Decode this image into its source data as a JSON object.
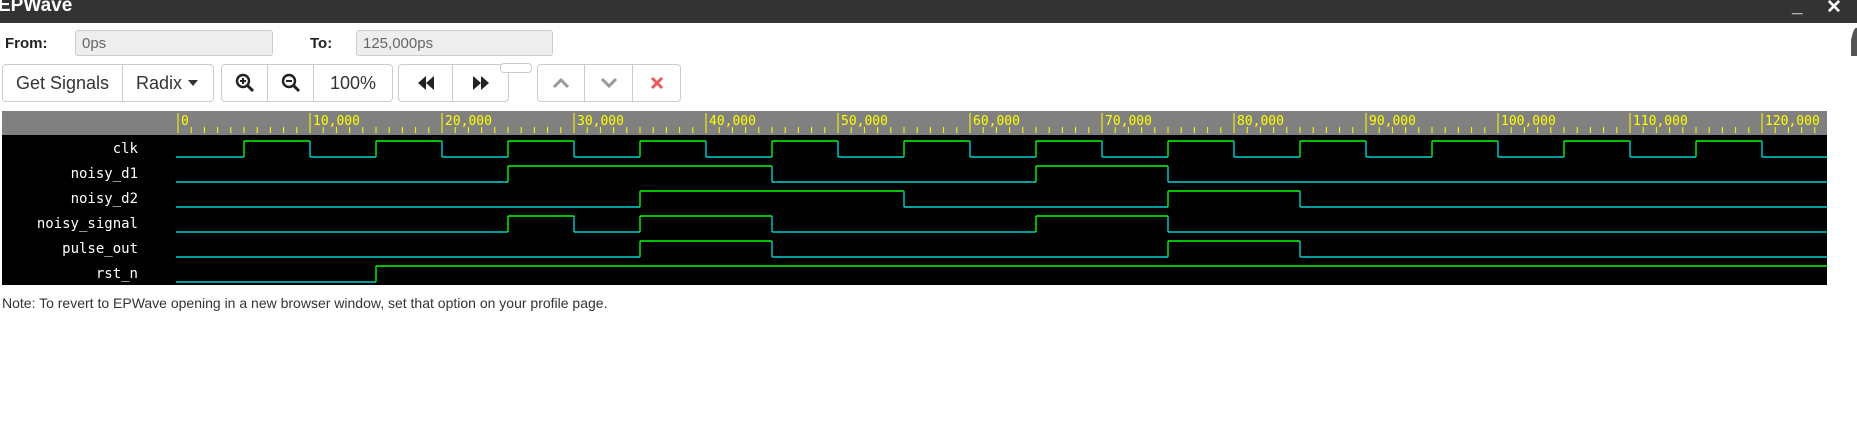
{
  "window": {
    "title": "EPWave",
    "minimize_icon": "minimize-icon",
    "close_icon": "close-icon",
    "minimize_glyph": "_",
    "close_glyph": "✕"
  },
  "range": {
    "from_label": "From:",
    "from_value": "0ps",
    "to_label": "To:",
    "to_value": "125,000ps"
  },
  "toolbar": {
    "get_signals": "Get Signals",
    "radix": "Radix",
    "zoom_level": "100%",
    "icons": [
      "zoom-in-icon",
      "zoom-out-icon",
      "rewind-icon",
      "fast-forward-icon",
      "up-arrow-icon",
      "down-arrow-icon",
      "delete-icon"
    ],
    "delete_color": "#e8595d"
  },
  "waveform": {
    "time_unit": "ps",
    "start": 0,
    "end": 125000,
    "ruler_labels": [
      "0",
      "10,000",
      "20,000",
      "30,000",
      "40,000",
      "50,000",
      "60,000",
      "70,000",
      "80,000",
      "90,000",
      "100,000",
      "110,000",
      "120,000"
    ],
    "colors": {
      "high": "#00ff00",
      "low": "#00d0d0",
      "ruler_bg": "#808080",
      "ruler_text": "#ffff00"
    },
    "signals": [
      {
        "name": "clk",
        "initial": 0,
        "toggles": [
          5000,
          10000,
          15000,
          20000,
          25000,
          30000,
          35000,
          40000,
          45000,
          50000,
          55000,
          60000,
          65000,
          70000,
          75000,
          80000,
          85000,
          90000,
          95000,
          100000,
          105000,
          110000,
          115000,
          120000
        ]
      },
      {
        "name": "noisy_d1",
        "initial": 0,
        "toggles": [
          25000,
          45000,
          65000,
          75000
        ]
      },
      {
        "name": "noisy_d2",
        "initial": 0,
        "toggles": [
          35000,
          55000,
          75000,
          85000
        ]
      },
      {
        "name": "noisy_signal",
        "initial": 0,
        "toggles": [
          25000,
          30000,
          35000,
          45000,
          65000,
          75000
        ]
      },
      {
        "name": "pulse_out",
        "initial": 0,
        "toggles": [
          35000,
          45000,
          75000,
          85000
        ]
      },
      {
        "name": "rst_n",
        "initial": 0,
        "toggles": [
          15000
        ]
      }
    ]
  },
  "note": "Note: To revert to EPWave opening in a new browser window, set that option on your profile page."
}
